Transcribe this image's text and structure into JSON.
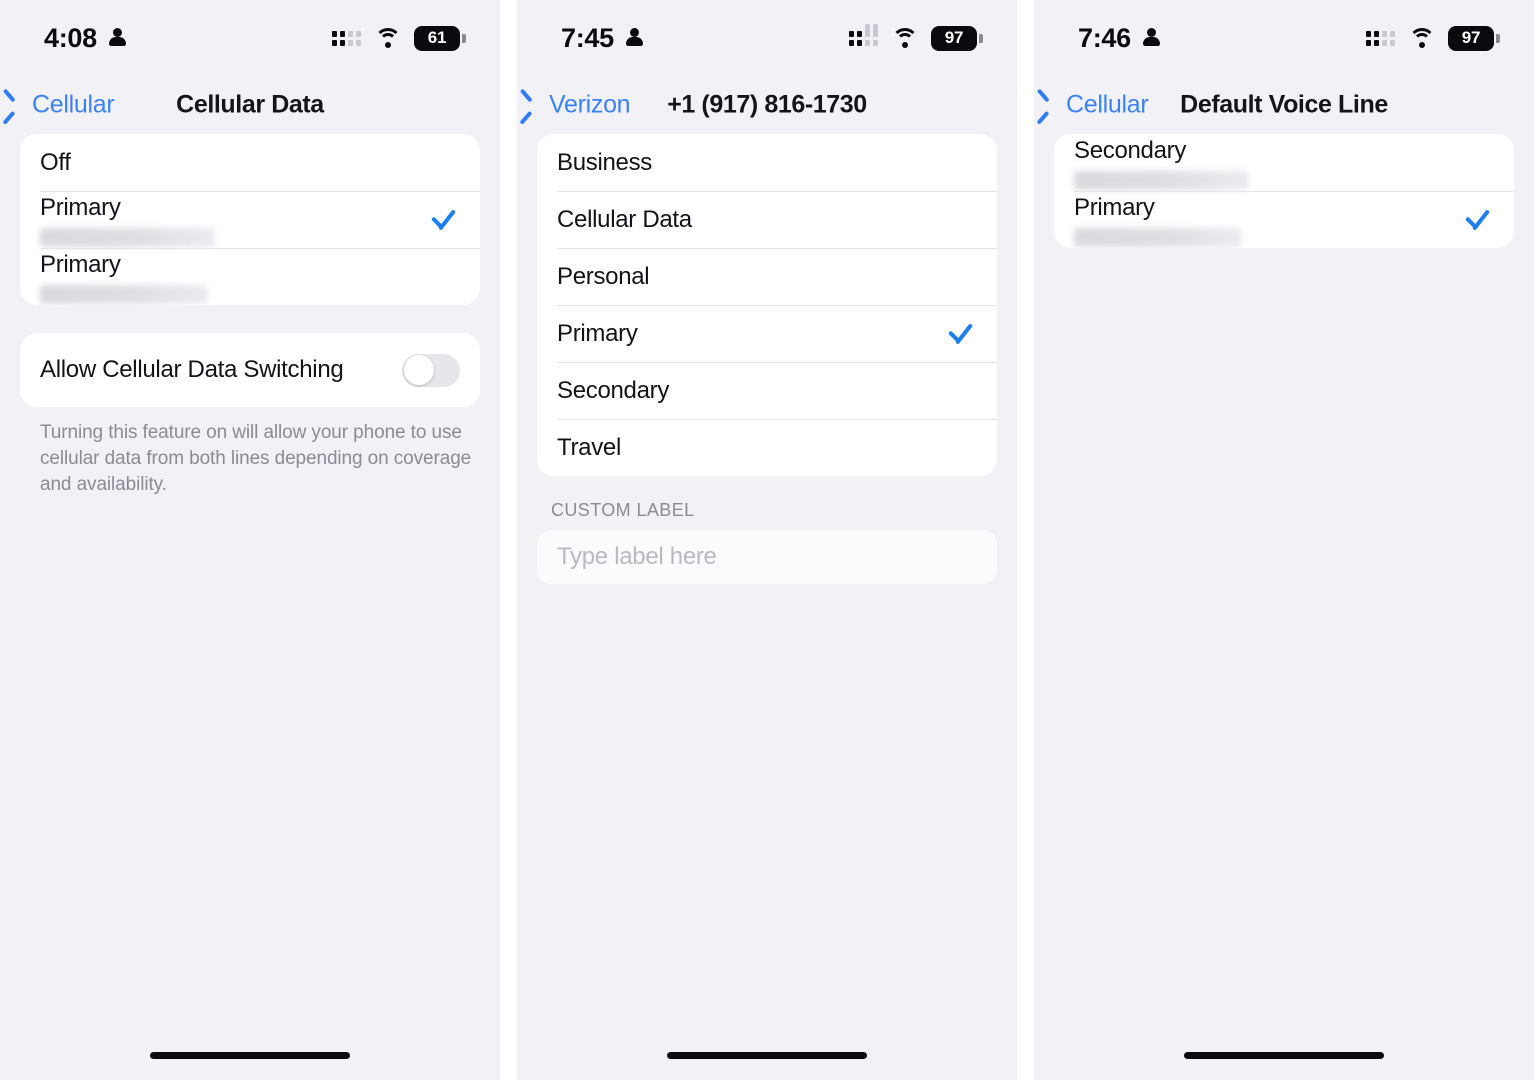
{
  "panels": [
    {
      "status": {
        "time": "4:08",
        "person_icon": "person-icon",
        "signal_icon": "cellular-signal-icon",
        "wifi_icon": "wifi-icon",
        "battery": "61"
      },
      "nav": {
        "back_label": "Cellular",
        "title": "Cellular Data"
      },
      "list": [
        {
          "title": "Off",
          "redacted": false,
          "checked": false
        },
        {
          "title": "Primary",
          "redacted": true,
          "checked": true
        },
        {
          "title": "Primary",
          "redacted": true,
          "checked": false
        }
      ],
      "toggle_row": {
        "label": "Allow Cellular Data Switching",
        "state": "off"
      },
      "footnote": "Turning this feature on will allow your phone to use cellular data from both lines depending on coverage and availability."
    },
    {
      "status": {
        "time": "7:45",
        "person_icon": "person-icon",
        "signal_icon": "cellular-signal-icon",
        "wifi_icon": "wifi-icon",
        "battery": "97"
      },
      "nav": {
        "back_label": "Verizon",
        "title": "+1 (917) 816-1730"
      },
      "list": [
        {
          "title": "Business",
          "redacted": false,
          "checked": false
        },
        {
          "title": "Cellular Data",
          "redacted": false,
          "checked": false
        },
        {
          "title": "Personal",
          "redacted": false,
          "checked": false
        },
        {
          "title": "Primary",
          "redacted": false,
          "checked": true
        },
        {
          "title": "Secondary",
          "redacted": false,
          "checked": false
        },
        {
          "title": "Travel",
          "redacted": false,
          "checked": false
        }
      ],
      "section_header": "CUSTOM LABEL",
      "custom_label_input": {
        "value": "",
        "placeholder": "Type label here"
      }
    },
    {
      "status": {
        "time": "7:46",
        "person_icon": "person-icon",
        "signal_icon": "cellular-signal-icon",
        "wifi_icon": "wifi-icon",
        "battery": "97"
      },
      "nav": {
        "back_label": "Cellular",
        "title": "Default Voice Line"
      },
      "list": [
        {
          "title": "Secondary",
          "redacted": true,
          "checked": false
        },
        {
          "title": "Primary",
          "redacted": true,
          "checked": true
        }
      ]
    }
  ],
  "colors": {
    "accent": "#1b7ef2",
    "link": "#3b82f6",
    "background": "#f1f1f6",
    "card": "#ffffff",
    "separator": "#e4e4e9",
    "secondary_text": "#8b8b94"
  }
}
